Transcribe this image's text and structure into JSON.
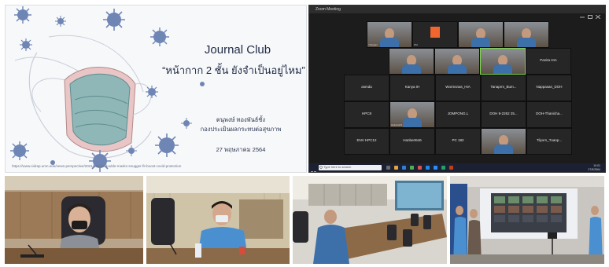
{
  "slide": {
    "title": "Journal Club",
    "subtitle": "“หน้ากาก 2 ชั้น ยังจำเป็นอยู่ไหม”",
    "presenter": "ตนุพงษ์ ทองพันธ์ชั้ง",
    "department": "กองประเมินผลกระทบต่อสุขภาพ",
    "date": "27 พฤษภาคม 2564",
    "source_url": "https://www.cidrap.umn.edu/news-perspective/2021/02/cdc-double-masks-snugger-fit-boost-covid-protection"
  },
  "zoom": {
    "window_title": "Zoom Meeting",
    "tiles": [
      {
        "label": "",
        "caption": "Yuhapan",
        "video": true
      },
      {
        "label": "",
        "caption": "Wd",
        "video": false,
        "avatar": true
      },
      {
        "label": "",
        "caption": "",
        "video": true
      },
      {
        "label": "",
        "caption": "",
        "video": true
      },
      {
        "label": "",
        "caption": "",
        "video": true
      },
      {
        "label": "",
        "caption": "",
        "video": true
      },
      {
        "label": "",
        "caption": "",
        "video": true
      },
      {
        "label": "Panita HIA",
        "caption": "",
        "video": false
      },
      {
        "label": "asmda",
        "caption": "",
        "video": false
      },
      {
        "label": "Kanya IH",
        "caption": "",
        "video": false
      },
      {
        "label": "Wormsnas_HIA",
        "caption": "",
        "video": false
      },
      {
        "label": "Tanaprm_Bum...",
        "caption": "",
        "video": false
      },
      {
        "label": "Nappasan_DOH",
        "caption": "",
        "video": false
      },
      {
        "label": "HPC8",
        "caption": "",
        "video": false
      },
      {
        "label": "",
        "caption": "Hakanta01",
        "video": true
      },
      {
        "label": "JOMPONG.L",
        "caption": "",
        "video": false
      },
      {
        "label": "DOH 9-2262 25...",
        "caption": "",
        "video": false
      },
      {
        "label": "DOH-Thanicha...",
        "caption": "",
        "video": false
      },
      {
        "label": "ENV HPC12",
        "caption": "",
        "video": false
      },
      {
        "label": "Hanbert646",
        "caption": "",
        "video": false
      },
      {
        "label": "PC 182",
        "caption": "",
        "video": false
      },
      {
        "label": "",
        "caption": "",
        "video": true
      },
      {
        "label": "Tilyorn_Tuanp...",
        "caption": "",
        "video": false
      }
    ],
    "taskbar": {
      "search_placeholder": "Type here to search",
      "time": "10:01",
      "date": "27/5/2564"
    }
  },
  "photos": [
    {
      "name": "presenter-photo"
    },
    {
      "name": "participant-photo"
    },
    {
      "name": "meeting-room-photo"
    },
    {
      "name": "screen-room-photo"
    }
  ],
  "colors": {
    "virus": "#6f86b5",
    "mask": "#8fb7b8",
    "zoom_bg": "#1c1c1c",
    "active_speaker": "#7dd64b",
    "taskbar": "#1b2133"
  }
}
